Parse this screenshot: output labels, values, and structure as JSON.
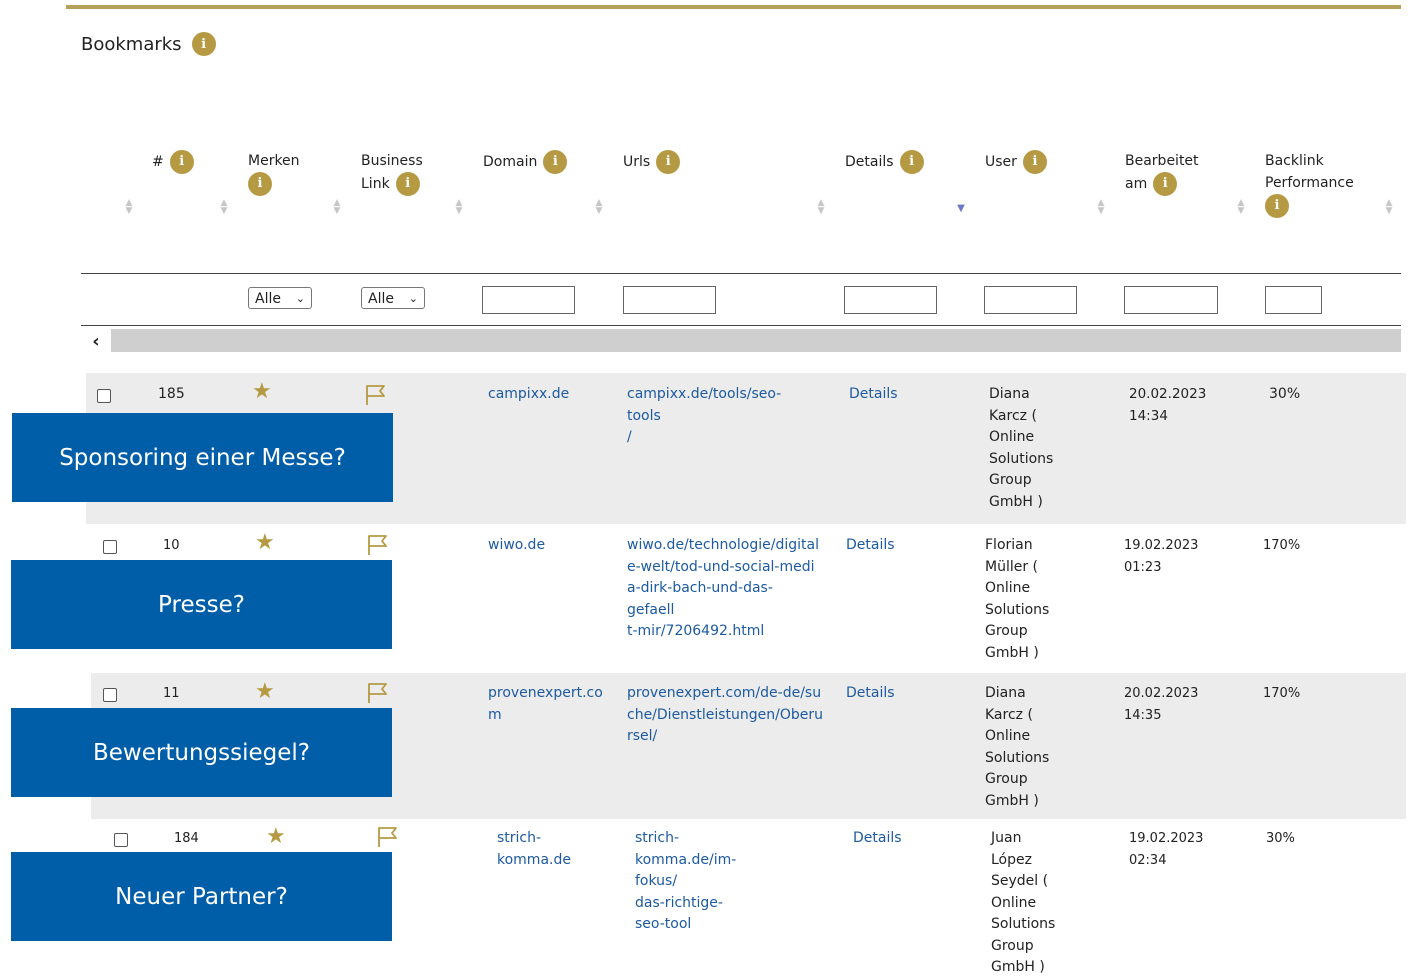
{
  "page": {
    "title": "Bookmarks"
  },
  "colors": {
    "accent": "#b59a43",
    "link": "#1d5aa0",
    "overlay": "#005ea8",
    "row_bg": "#ececec"
  },
  "headers": [
    {
      "label": "#"
    },
    {
      "label": "Merken"
    },
    {
      "label": "Business Link",
      "line1": "Business",
      "line2": "Link"
    },
    {
      "label": "Domain"
    },
    {
      "label": "Urls"
    },
    {
      "label": "Details"
    },
    {
      "label": "User"
    },
    {
      "label": "Bearbeitet am",
      "line1": "Bearbeitet",
      "line2": "am"
    },
    {
      "label": "Backlink Performance",
      "line1": "Backlink",
      "line2": "Performance"
    }
  ],
  "filters": {
    "merken": "Alle",
    "business_link": "Alle"
  },
  "rows": [
    {
      "id": "185",
      "domain": "campixx.de",
      "url_lines": [
        "campixx.de/tools/seo-tools",
        "/"
      ],
      "details": "Details",
      "user_lines": [
        "Diana Karcz (",
        "Online Solutions",
        "Group GmbH )"
      ],
      "date": "20.02.2023 14:34",
      "performance": "30%"
    },
    {
      "id": "10",
      "domain": "wiwo.de",
      "url_lines": [
        "wiwo.de/technologie/digital",
        "e-welt/tod-und-social-medi",
        "a-dirk-bach-und-das-gefaell",
        "t-mir/7206492.html"
      ],
      "details": "Details",
      "user_lines": [
        "Florian Müller (",
        "Online Solutions",
        "Group GmbH )"
      ],
      "date": "19.02.2023 01:23",
      "performance": "170%"
    },
    {
      "id": "11",
      "domain_lines": [
        "provenexpert.co",
        "m"
      ],
      "url_lines": [
        "provenexpert.com/de-de/su",
        "che/Dienstleistungen/Oberu",
        "rsel/"
      ],
      "details": "Details",
      "user_lines": [
        "Diana Karcz (",
        "Online Solutions",
        "Group GmbH )"
      ],
      "date": "20.02.2023 14:35",
      "performance": "170%"
    },
    {
      "id": "184",
      "domain": "strich-komma.de",
      "url_lines": [
        "strich-komma.de/im-fokus/",
        "das-richtige-seo-tool"
      ],
      "details": "Details",
      "user_lines": [
        "Juan López",
        "Seydel ( Online",
        "Solutions Group",
        "GmbH )"
      ],
      "date": "19.02.2023 02:34",
      "performance": "30%"
    }
  ],
  "overlays": [
    "Sponsoring einer Messe?",
    "Presse?",
    "Bewertungssiegel?",
    "Neuer Partner?"
  ]
}
